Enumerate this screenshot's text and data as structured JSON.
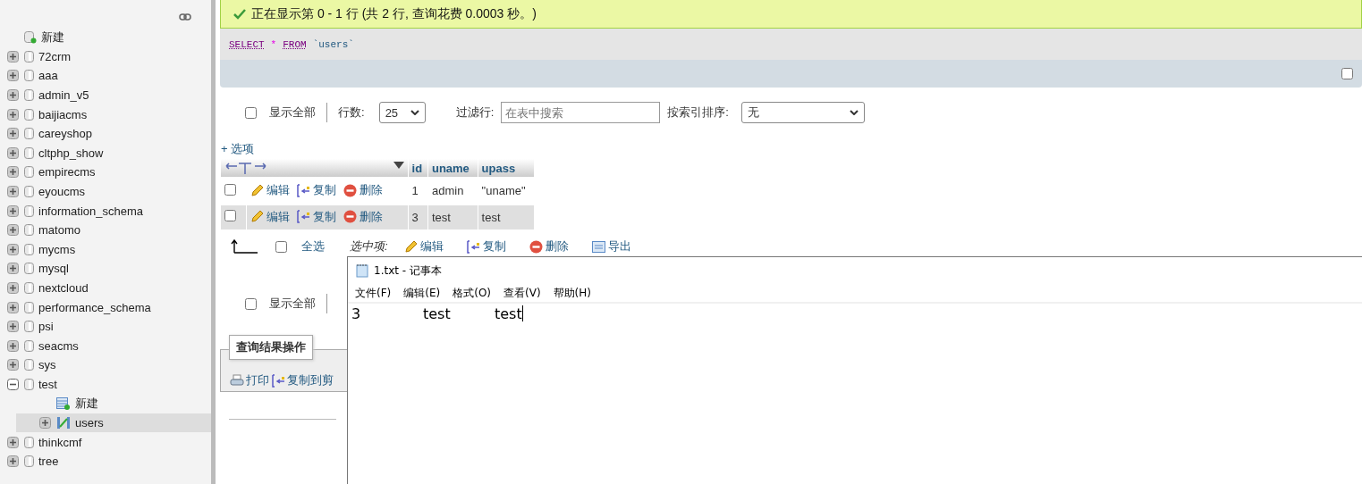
{
  "sidebar": {
    "tree": [
      {
        "label": "新建",
        "kind": "new",
        "selected": false
      },
      {
        "label": "72crm",
        "kind": "database",
        "expanded": false,
        "selected": false
      },
      {
        "label": "aaa",
        "kind": "database",
        "expanded": false,
        "selected": false
      },
      {
        "label": "admin_v5",
        "kind": "database",
        "expanded": false,
        "selected": false
      },
      {
        "label": "baijiacms",
        "kind": "database",
        "expanded": false,
        "selected": false
      },
      {
        "label": "careyshop",
        "kind": "database",
        "expanded": false,
        "selected": false
      },
      {
        "label": "cltphp_show",
        "kind": "database",
        "expanded": false,
        "selected": false
      },
      {
        "label": "empirecms",
        "kind": "database",
        "expanded": false,
        "selected": false
      },
      {
        "label": "eyoucms",
        "kind": "database",
        "expanded": false,
        "selected": false
      },
      {
        "label": "information_schema",
        "kind": "database",
        "expanded": false,
        "selected": false
      },
      {
        "label": "matomo",
        "kind": "database",
        "expanded": false,
        "selected": false
      },
      {
        "label": "mycms",
        "kind": "database",
        "expanded": false,
        "selected": false
      },
      {
        "label": "mysql",
        "kind": "database",
        "expanded": false,
        "selected": false
      },
      {
        "label": "nextcloud",
        "kind": "database",
        "expanded": false,
        "selected": false
      },
      {
        "label": "performance_schema",
        "kind": "database",
        "expanded": false,
        "selected": false
      },
      {
        "label": "psi",
        "kind": "database",
        "expanded": false,
        "selected": false
      },
      {
        "label": "seacms",
        "kind": "database",
        "expanded": false,
        "selected": false
      },
      {
        "label": "sys",
        "kind": "database",
        "expanded": false,
        "selected": false
      },
      {
        "label": "test",
        "kind": "database",
        "expanded": true,
        "selected": false,
        "children": [
          {
            "label": "新建",
            "kind": "new-table",
            "selected": false
          },
          {
            "label": "users",
            "kind": "table",
            "expanded": false,
            "selected": true
          }
        ]
      },
      {
        "label": "thinkcmf",
        "kind": "database",
        "expanded": false,
        "selected": false
      },
      {
        "label": "tree",
        "kind": "database",
        "expanded": false,
        "selected": false
      }
    ]
  },
  "message": "正在显示第 0 - 1 行 (共 2 行, 查询花费 0.0003 秒。)",
  "sql": [
    {
      "text": "SELECT",
      "kind": "keyword"
    },
    {
      "text": "*",
      "kind": "operator"
    },
    {
      "text": "FROM",
      "kind": "keyword"
    },
    {
      "text": "`users`",
      "kind": "identifier"
    }
  ],
  "toolbar_checkbox": {
    "checked": false
  },
  "controls": {
    "show_all": {
      "label": "显示全部",
      "checked": false
    },
    "rows_label": "行数:",
    "rows_value": "25",
    "filter_label": "过滤行:",
    "filter_placeholder": "在表中搜索",
    "sort_label": "按索引排序:",
    "sort_value": "无"
  },
  "options_link": "+ 选项",
  "table": {
    "columns": [
      "id",
      "uname",
      "upass"
    ],
    "rows": [
      {
        "checked": false,
        "highlighted": false,
        "actions": [
          "编辑",
          "复制",
          "删除"
        ],
        "cells": [
          "1",
          "admin",
          "\"uname\""
        ]
      },
      {
        "checked": false,
        "highlighted": true,
        "actions": [
          "编辑",
          "复制",
          "删除"
        ],
        "cells": [
          "3",
          "test",
          "test"
        ]
      }
    ]
  },
  "bulk": {
    "check_all": {
      "label": "全选",
      "checked": false
    },
    "selected_label": "选中项:",
    "actions": [
      {
        "label": "编辑",
        "kind": "edit"
      },
      {
        "label": "复制",
        "kind": "copy"
      },
      {
        "label": "删除",
        "kind": "delete"
      },
      {
        "label": "导出",
        "kind": "export"
      }
    ]
  },
  "bottom_controls": {
    "show_all": {
      "label": "显示全部",
      "checked": false
    }
  },
  "query_ops": {
    "legend": "查询结果操作",
    "actions": [
      {
        "label": "打印",
        "kind": "print"
      },
      {
        "label": "复制到剪",
        "kind": "copy"
      }
    ]
  },
  "notepad": {
    "title": "1.txt - 记事本",
    "menu": [
      "文件(F)",
      "编辑(E)",
      "格式(O)",
      "查看(V)",
      "帮助(H)"
    ],
    "lines": [
      [
        "3",
        "test",
        "test"
      ]
    ]
  }
}
